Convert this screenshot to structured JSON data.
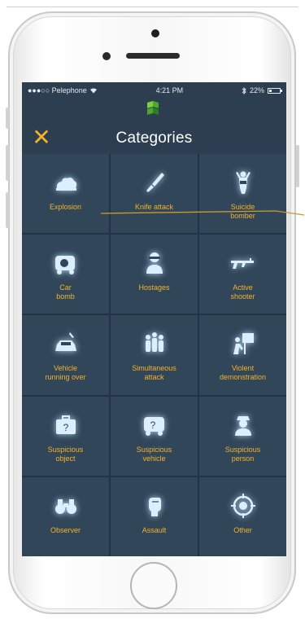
{
  "status_bar": {
    "carrier": "●●●○○ Pelephone",
    "time": "4:21 PM",
    "battery": "22%"
  },
  "header": {
    "close_icon": "close-x-icon",
    "title": "Categories"
  },
  "colors": {
    "accent": "#f2b32a",
    "screen_bg": "#2d3e50",
    "tile_bg": "#324659",
    "icon_glow": "#dcefff"
  },
  "categories": [
    {
      "label": "Explosion",
      "icon": "explosion-icon"
    },
    {
      "label": "Knife attack",
      "icon": "knife-icon"
    },
    {
      "label": "Suicide\nbomber",
      "icon": "suicide-bomber-icon"
    },
    {
      "label": "Car\nbomb",
      "icon": "car-bomb-icon"
    },
    {
      "label": "Hostages",
      "icon": "hostages-icon"
    },
    {
      "label": "Active\nshooter",
      "icon": "rifle-icon"
    },
    {
      "label": "Vehicle\nrunning over",
      "icon": "vehicle-running-over-icon"
    },
    {
      "label": "Simultaneous\nattack",
      "icon": "simultaneous-attack-icon"
    },
    {
      "label": "Violent\ndemonstration",
      "icon": "violent-demonstration-icon"
    },
    {
      "label": "Suspicious\nobject",
      "icon": "suspicious-object-icon"
    },
    {
      "label": "Suspicious\nvehicle",
      "icon": "suspicious-vehicle-icon"
    },
    {
      "label": "Suspicious\nperson",
      "icon": "suspicious-person-icon"
    },
    {
      "label": "Observer",
      "icon": "binoculars-icon"
    },
    {
      "label": "Assault",
      "icon": "fist-icon"
    },
    {
      "label": "Other",
      "icon": "target-icon"
    }
  ]
}
